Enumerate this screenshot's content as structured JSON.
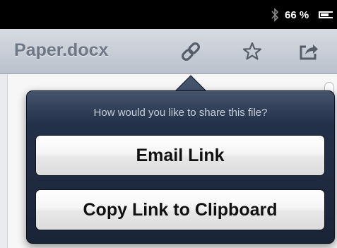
{
  "status_bar": {
    "bluetooth_icon": "bluetooth-icon",
    "battery_percent": "66 %",
    "battery_icon": "battery-icon",
    "battery_level": 0.66
  },
  "toolbar": {
    "title": "Paper.docx",
    "buttons": [
      {
        "name": "link-button",
        "icon": "link-icon"
      },
      {
        "name": "favorite-button",
        "icon": "star-icon"
      },
      {
        "name": "share-button",
        "icon": "share-icon"
      }
    ]
  },
  "share_popover": {
    "prompt": "How would you like to share this file?",
    "options": [
      {
        "label": "Email Link"
      },
      {
        "label": "Copy Link to Clipboard"
      }
    ]
  }
}
